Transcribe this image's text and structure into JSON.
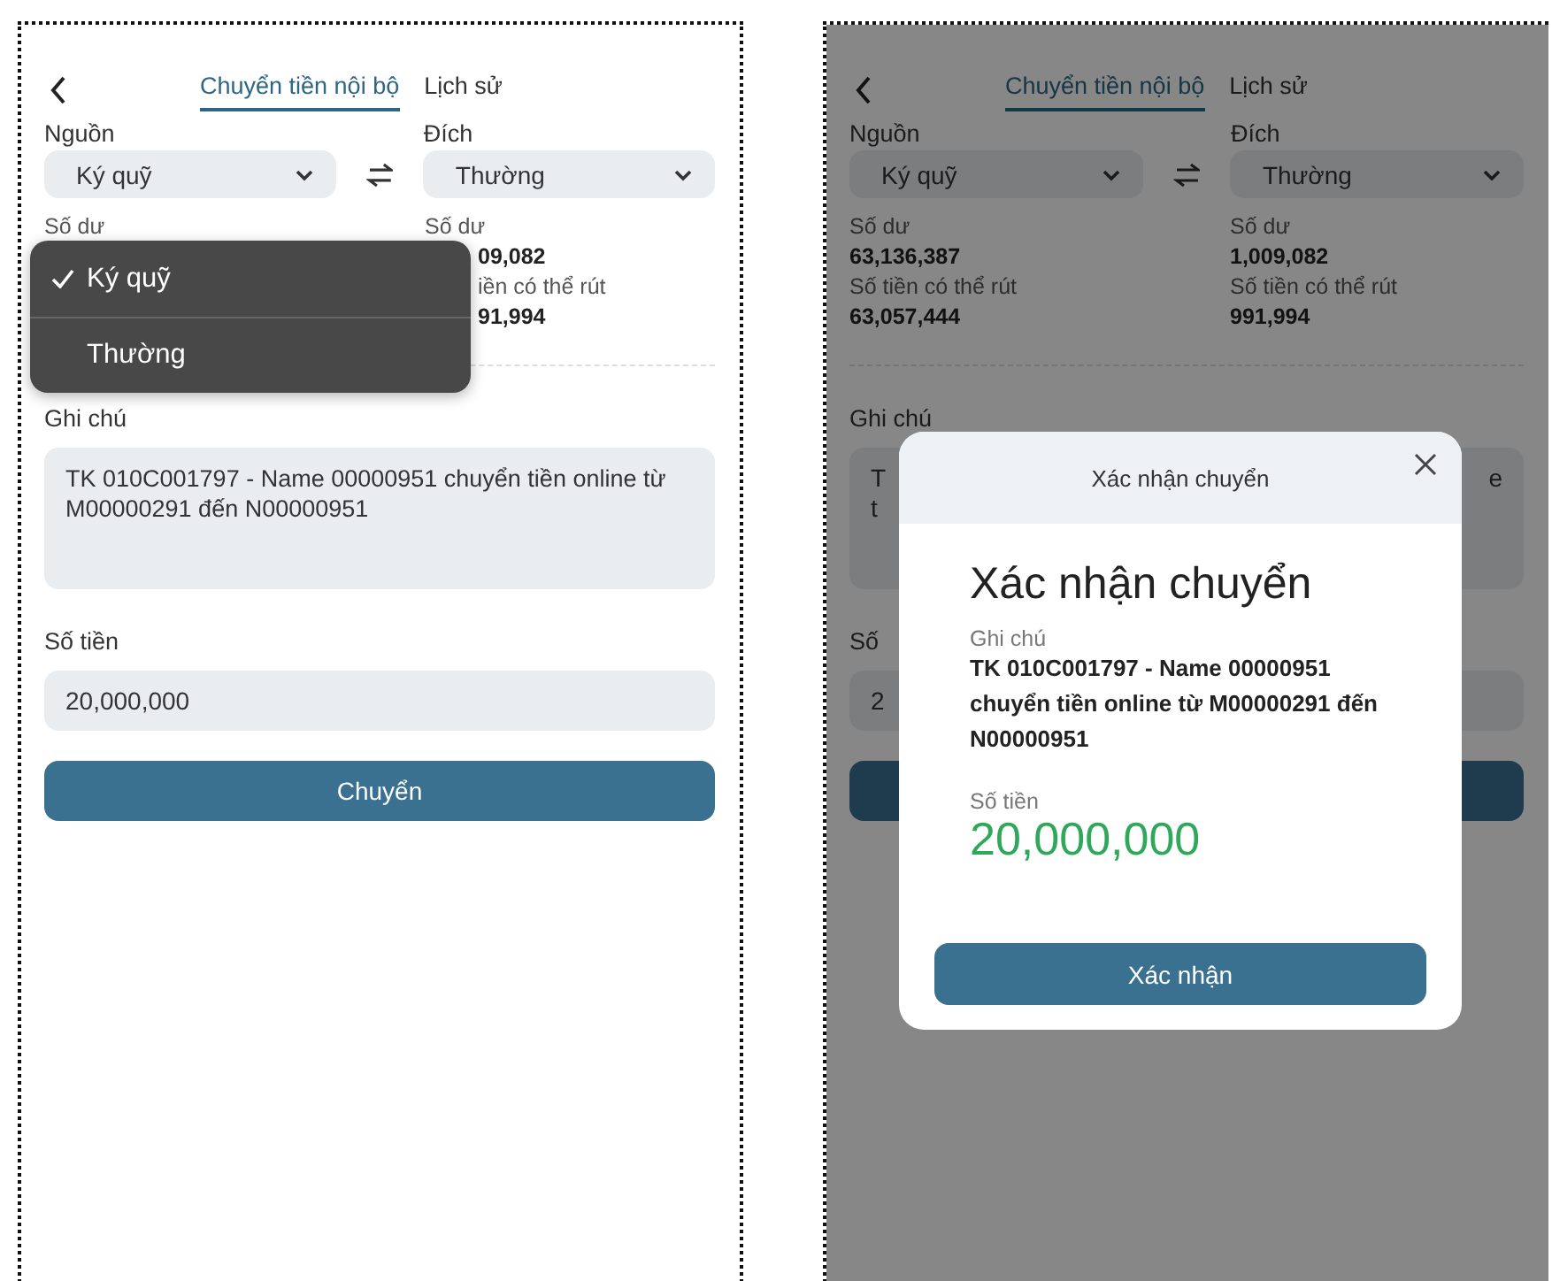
{
  "screens": [
    {
      "tabs": [
        {
          "label": "Chuyển tiền nội bộ",
          "selected": true
        },
        {
          "label": "Lịch sử",
          "selected": false
        }
      ],
      "source": {
        "label": "Nguồn",
        "value": "Ký quỹ"
      },
      "target": {
        "label": "Đích",
        "value": "Thường"
      },
      "balances": [
        [
          {
            "kind": "label",
            "text": "Số dư",
            "partial": false
          }
        ],
        [
          {
            "kind": "label",
            "text": "Số dư",
            "partial": false
          },
          {
            "kind": "value",
            "text": "09,082",
            "partial": true
          },
          {
            "kind": "label",
            "text": "iền có thể rút",
            "partial": true
          },
          {
            "kind": "value",
            "text": "91,994",
            "partial": true
          }
        ]
      ],
      "note": {
        "label": "Ghi chú",
        "value": "TK 010C001797 - Name 00000951 chuyển tiền online từ M00000291 đến N00000951"
      },
      "amount": {
        "label": "Số tiền",
        "value": "20,000,000"
      },
      "submit_button": {
        "label": "Chuyển"
      },
      "dropdown": {
        "options": [
          {
            "label": "Ký quỹ",
            "selected": true
          },
          {
            "label": "Thường",
            "selected": false
          }
        ]
      }
    },
    {
      "tabs": [
        {
          "label": "Chuyển tiền nội bộ",
          "selected": true
        },
        {
          "label": "Lịch sử",
          "selected": false
        }
      ],
      "source": {
        "label": "Nguồn",
        "value": "Ký quỹ"
      },
      "target": {
        "label": "Đích",
        "value": "Thường"
      },
      "balances": [
        [
          {
            "kind": "label",
            "text": "Số dư",
            "partial": false
          },
          {
            "kind": "value",
            "text": "63,136,387",
            "partial": false
          },
          {
            "kind": "label",
            "text": "Số tiền có thể rút",
            "partial": false
          },
          {
            "kind": "value",
            "text": "63,057,444",
            "partial": false
          }
        ],
        [
          {
            "kind": "label",
            "text": "Số dư",
            "partial": false
          },
          {
            "kind": "value",
            "text": "1,009,082",
            "partial": false
          },
          {
            "kind": "label",
            "text": "Số tiền có thể rút",
            "partial": false
          },
          {
            "kind": "value",
            "text": "991,994",
            "partial": false
          }
        ]
      ],
      "note": {
        "label": "Ghi chú",
        "fragments_left": [
          "T",
          "t"
        ],
        "fragments_right": [
          "e"
        ]
      },
      "amount": {
        "label": "Số",
        "value": "2"
      },
      "dialog": {
        "title": "Xác nhận chuyển",
        "heading": "Xác nhận chuyển",
        "note_label": "Ghi chú",
        "note": "TK 010C001797 - Name 00000951 chuyển tiền online từ M00000291 đến N00000951",
        "amount_label": "Số tiền",
        "amount": "20,000,000",
        "confirm_button": "Xác nhận"
      }
    }
  ]
}
